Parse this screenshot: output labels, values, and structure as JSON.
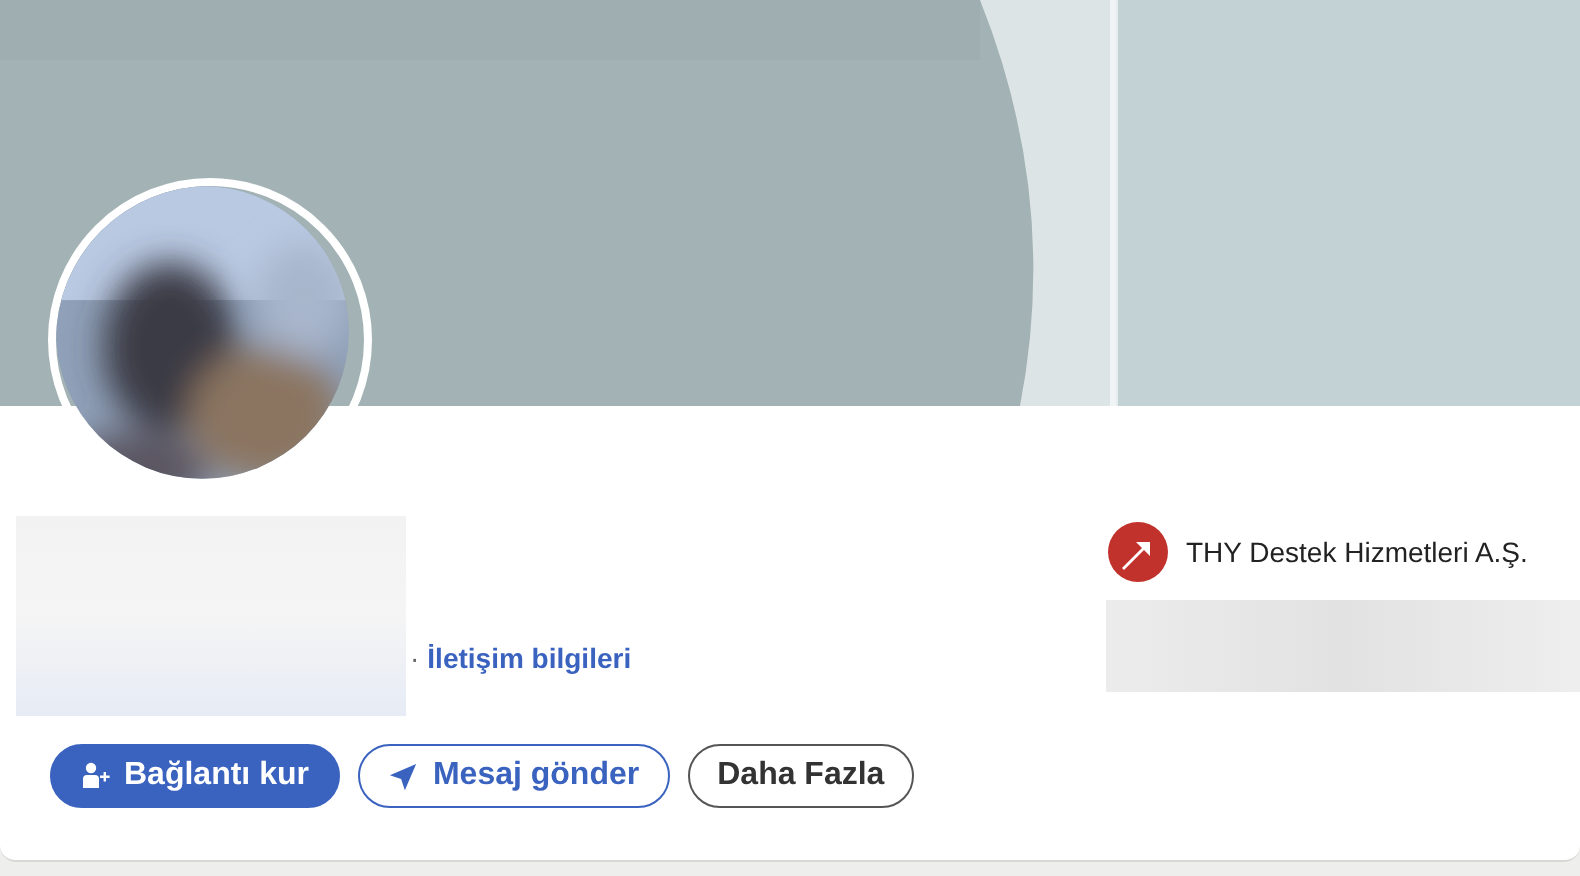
{
  "profile": {
    "separator": "·",
    "contact_link": "İletişim bilgileri"
  },
  "actions": [
    {
      "kind": "primary",
      "label": "Bağlantı kur"
    },
    {
      "kind": "secondary",
      "label": "Mesaj gönder"
    },
    {
      "kind": "outline",
      "label": "Daha Fazla"
    }
  ],
  "company": {
    "name": "THY Destek Hizmetleri A.Ş."
  }
}
